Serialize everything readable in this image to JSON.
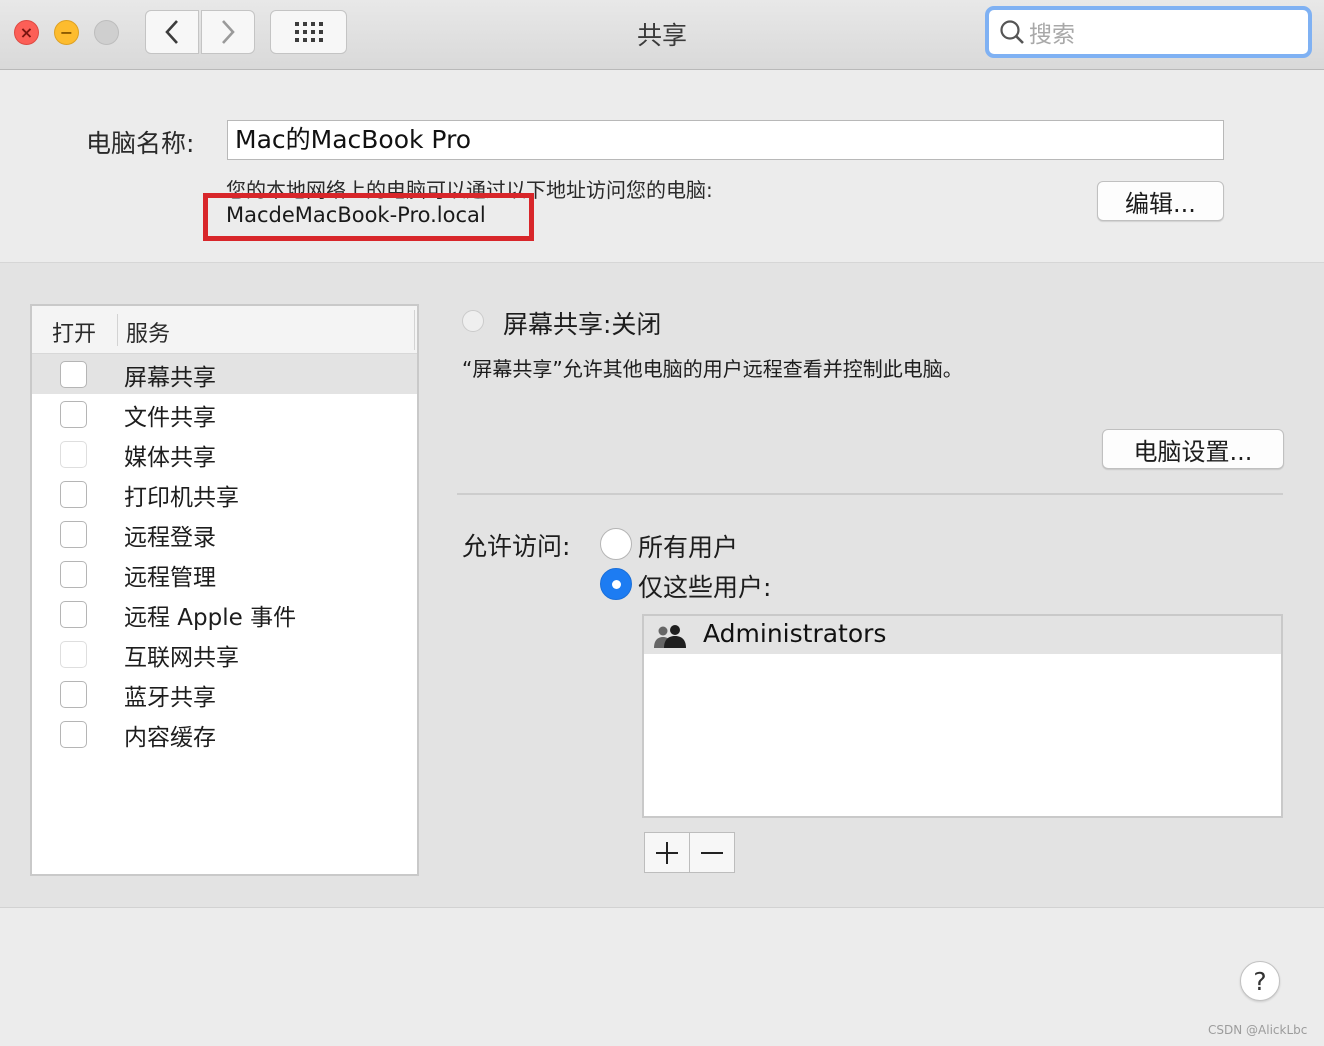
{
  "window": {
    "title": "共享",
    "search_placeholder": "搜索"
  },
  "computer": {
    "name_label": "电脑名称:",
    "name_value": "Mac的MacBook Pro",
    "address_description": "您的本地网络上的电脑可以通过以下地址访问您的电脑:",
    "address_value": "MacdeMacBook-Pro.local",
    "edit_button": "编辑..."
  },
  "services": {
    "header_open": "打开",
    "header_service": "服务",
    "items": [
      {
        "label": "屏幕共享",
        "checked": false,
        "selected": true
      },
      {
        "label": "文件共享",
        "checked": false
      },
      {
        "label": "媒体共享",
        "checked": false,
        "dimmed": true
      },
      {
        "label": "打印机共享",
        "checked": false
      },
      {
        "label": "远程登录",
        "checked": false
      },
      {
        "label": "远程管理",
        "checked": false
      },
      {
        "label": "远程 Apple 事件",
        "checked": false
      },
      {
        "label": "互联网共享",
        "checked": false,
        "dimmed": true
      },
      {
        "label": "蓝牙共享",
        "checked": false
      },
      {
        "label": "内容缓存",
        "checked": false
      }
    ]
  },
  "detail": {
    "status": "屏幕共享:关闭",
    "description": "“屏幕共享”允许其他电脑的用户远程查看并控制此电脑。",
    "computer_settings_button": "电脑设置...",
    "access_label": "允许访问:",
    "option_all_users": "所有用户",
    "option_these_users": "仅这些用户:",
    "selected_option": "仅这些用户",
    "users": [
      {
        "name": "Administrators",
        "icon": "group-icon"
      }
    ],
    "add_label": "+",
    "remove_label": "−"
  },
  "help_label": "?",
  "watermark": "CSDN @AlickLbc",
  "colors": {
    "accent": "#1d7cf2",
    "highlight_box": "#d8262a",
    "close": "#fc5f57",
    "minimize": "#fdbc2e"
  }
}
